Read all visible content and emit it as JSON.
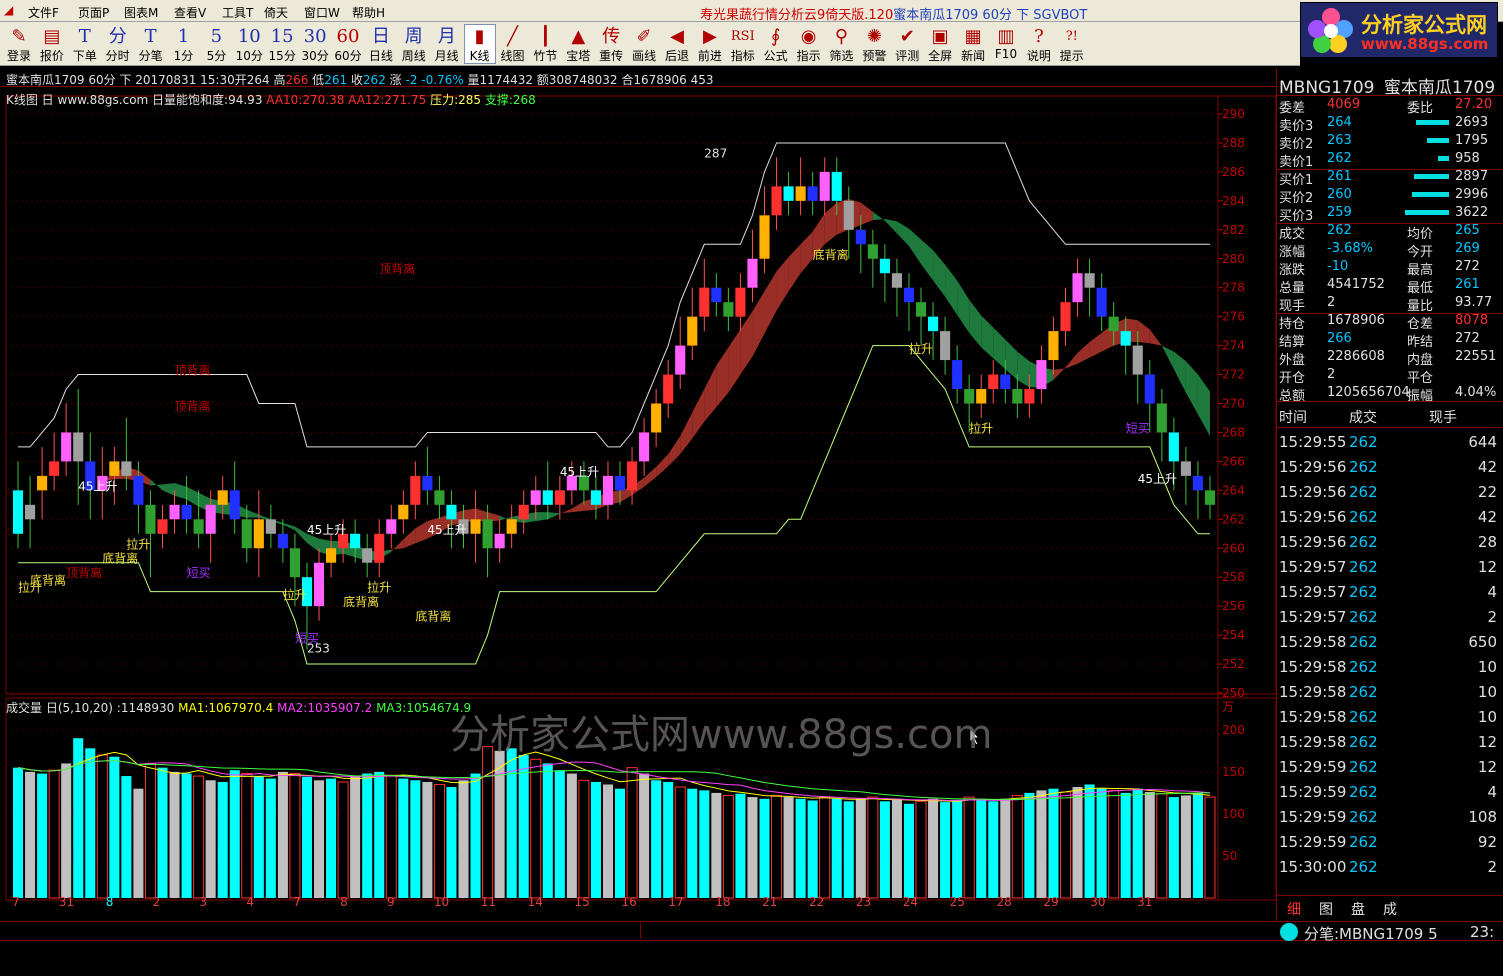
{
  "menu": {
    "items": [
      "文件F",
      "页面P",
      "图表M",
      "查看V",
      "工具T",
      "倚天",
      "窗口W",
      "帮助H"
    ],
    "title_a": "寿光果蔬行情分析云9倚天版.120",
    "title_b": "蜜本南瓜1709 60分 下 SGVBOT"
  },
  "logo": {
    "line1": "分析家公式网",
    "line2": "www.88gs.com"
  },
  "toolbar": [
    {
      "icon": "pencil-icon",
      "glyph": "✎",
      "label": "登录"
    },
    {
      "icon": "quote-icon",
      "glyph": "▤",
      "label": "报价"
    },
    {
      "icon": "order-icon",
      "glyph": "T",
      "label": "下单"
    },
    {
      "icon": "intraday-icon",
      "glyph": "分",
      "label": "分时"
    },
    {
      "icon": "tick-icon",
      "glyph": "T",
      "label": "分笔"
    },
    {
      "icon": "1min-icon",
      "glyph": "1",
      "label": "1分"
    },
    {
      "icon": "5min-icon",
      "glyph": "5",
      "label": "5分"
    },
    {
      "icon": "10min-icon",
      "glyph": "10",
      "label": "10分"
    },
    {
      "icon": "15min-icon",
      "glyph": "15",
      "label": "15分"
    },
    {
      "icon": "30min-icon",
      "glyph": "30",
      "label": "30分"
    },
    {
      "icon": "60min-icon",
      "glyph": "60",
      "label": "60分"
    },
    {
      "icon": "day-icon",
      "glyph": "日",
      "label": "日线"
    },
    {
      "icon": "week-icon",
      "glyph": "周",
      "label": "周线"
    },
    {
      "icon": "month-icon",
      "glyph": "月",
      "label": "月线"
    },
    {
      "icon": "candle-icon",
      "glyph": "▮",
      "label": "K线"
    },
    {
      "icon": "line-icon",
      "glyph": "╱",
      "label": "线图"
    },
    {
      "icon": "bamboo-icon",
      "glyph": "┃",
      "label": "竹节"
    },
    {
      "icon": "tower-icon",
      "glyph": "▲",
      "label": "宝塔"
    },
    {
      "icon": "retransmit-icon",
      "glyph": "传",
      "label": "重传"
    },
    {
      "icon": "draw-icon",
      "glyph": "✐",
      "label": "画线"
    },
    {
      "icon": "back-icon",
      "glyph": "◀",
      "label": "后退"
    },
    {
      "icon": "forward-icon",
      "glyph": "▶",
      "label": "前进"
    },
    {
      "icon": "indicator-icon",
      "glyph": "RSI",
      "label": "指标"
    },
    {
      "icon": "formula-icon",
      "glyph": "∮",
      "label": "公式"
    },
    {
      "icon": "hint-icon",
      "glyph": "◉",
      "label": "指示"
    },
    {
      "icon": "filter-icon",
      "glyph": "⚲",
      "label": "筛选"
    },
    {
      "icon": "alert-icon",
      "glyph": "✺",
      "label": "预警"
    },
    {
      "icon": "evaluate-icon",
      "glyph": "✔",
      "label": "评测"
    },
    {
      "icon": "fullscreen-icon",
      "glyph": "▣",
      "label": "全屏"
    },
    {
      "icon": "news-icon",
      "glyph": "▦",
      "label": "新闻"
    },
    {
      "icon": "f10-icon",
      "glyph": "▥",
      "label": "F10"
    },
    {
      "icon": "help-icon",
      "glyph": "?",
      "label": "说明"
    },
    {
      "icon": "tip-icon",
      "glyph": "?!",
      "label": "提示"
    }
  ],
  "infobar": {
    "text": "蜜本南瓜1709 60分 下  20170831 15:30开264 高",
    "high": "266",
    "low_l": " 低",
    "low": "261",
    "close_l": " 收",
    "close": "262",
    "chg_l": " 涨",
    "chg": "-2",
    "pct": "-0.76%",
    "rest": " 量1174432 额308748032 合1678906 453"
  },
  "kline_header": {
    "name": "K线图 日 www.88gs.com 日量能饱和度:94.93",
    "aa10": "AA10:270.38",
    "aa12": "AA12:271.75",
    "press": "压力:285",
    "support": "支撑:268"
  },
  "vol_header": {
    "name": "成交量 日(5,10,20) :1148930",
    "ma1": "MA1:1067970.4",
    "ma2": "MA2:1035907.2",
    "ma3": "MA3:1054674.9"
  },
  "watermark": "分析家公式网www.88gs.com",
  "price_ticks": [
    "290",
    "288",
    "286",
    "284",
    "282",
    "280",
    "278",
    "276",
    "274",
    "272",
    "270",
    "268",
    "266",
    "264",
    "262",
    "260",
    "258",
    "256",
    "254",
    "252",
    "250"
  ],
  "vol_ticks": [
    "万",
    "200",
    "150",
    "100",
    "50"
  ],
  "date_axis": [
    "7",
    "31",
    "8",
    "2",
    "3",
    "4",
    "7",
    "8",
    "9",
    "10",
    "11",
    "14",
    "15",
    "16",
    "17",
    "18",
    "21",
    "22",
    "23",
    "24",
    "25",
    "28",
    "29",
    "30",
    "31"
  ],
  "annotations": [
    {
      "t": "287",
      "c": "#e0e0e0"
    },
    {
      "t": "253",
      "c": "#e0e0e0"
    },
    {
      "t": "顶背离",
      "c": "#c00000"
    },
    {
      "t": "顶背离",
      "c": "#c00000"
    },
    {
      "t": "顶背离",
      "c": "#c00000"
    },
    {
      "t": "顶背离",
      "c": "#c00000"
    },
    {
      "t": "底背离",
      "c": "#f0e040"
    },
    {
      "t": "底背离",
      "c": "#f0e040"
    },
    {
      "t": "底背离",
      "c": "#f0e040"
    },
    {
      "t": "底背离",
      "c": "#f0e040"
    },
    {
      "t": "底背离",
      "c": "#f0e040"
    },
    {
      "t": "拉升",
      "c": "#f0e040"
    },
    {
      "t": "拉升",
      "c": "#f0e040"
    },
    {
      "t": "拉升",
      "c": "#f0e040"
    },
    {
      "t": "拉升",
      "c": "#f0e040"
    },
    {
      "t": "拉升",
      "c": "#f0e040"
    },
    {
      "t": "拉升",
      "c": "#f0e040"
    },
    {
      "t": "短买",
      "c": "#a030ff"
    },
    {
      "t": "短买",
      "c": "#a030ff"
    },
    {
      "t": "短买",
      "c": "#a030ff"
    },
    {
      "t": "45上升",
      "c": "#ffffff"
    },
    {
      "t": "45上升",
      "c": "#ffffff"
    },
    {
      "t": "45上升",
      "c": "#ffffff"
    },
    {
      "t": "45上升",
      "c": "#ffffff"
    },
    {
      "t": "45上升",
      "c": "#ffffff"
    }
  ],
  "chart_data": [
    {
      "type": "candlestick",
      "title": "K线图",
      "interval": "60分",
      "y_range": [
        250,
        290
      ],
      "candles": [
        [
          264,
          261,
          266,
          260
        ],
        [
          263,
          262,
          265,
          260
        ],
        [
          264,
          265,
          267,
          262
        ],
        [
          265,
          266,
          268,
          264
        ],
        [
          266,
          268,
          270,
          265
        ],
        [
          268,
          266,
          271,
          263
        ],
        [
          266,
          264,
          268,
          262
        ],
        [
          264,
          265,
          267,
          262
        ],
        [
          265,
          266,
          267,
          263
        ],
        [
          266,
          265,
          269,
          264
        ],
        [
          265,
          263,
          266,
          261
        ],
        [
          263,
          261,
          264,
          258
        ],
        [
          261,
          262,
          263,
          260
        ],
        [
          262,
          263,
          264,
          261
        ],
        [
          263,
          262,
          265,
          261
        ],
        [
          262,
          261,
          264,
          260
        ],
        [
          261,
          263,
          264,
          259
        ],
        [
          263,
          264,
          265,
          262
        ],
        [
          264,
          262,
          266,
          261
        ],
        [
          262,
          260,
          263,
          259
        ],
        [
          260,
          262,
          264,
          258
        ],
        [
          262,
          261,
          263,
          260
        ],
        [
          261,
          260,
          262,
          259
        ],
        [
          260,
          258,
          261,
          256
        ],
        [
          258,
          256,
          259,
          253
        ],
        [
          256,
          259,
          260,
          255
        ],
        [
          259,
          260,
          261,
          258
        ],
        [
          260,
          261,
          262,
          259
        ],
        [
          261,
          260,
          262,
          259
        ],
        [
          260,
          259,
          261,
          258
        ],
        [
          259,
          261,
          262,
          258
        ],
        [
          261,
          262,
          263,
          260
        ],
        [
          262,
          263,
          264,
          261
        ],
        [
          263,
          265,
          266,
          262
        ],
        [
          265,
          264,
          267,
          263
        ],
        [
          264,
          263,
          265,
          262
        ],
        [
          263,
          262,
          264,
          260
        ],
        [
          262,
          261,
          263,
          260
        ],
        [
          261,
          262,
          264,
          259
        ],
        [
          262,
          260,
          263,
          258
        ],
        [
          260,
          261,
          262,
          259
        ],
        [
          261,
          262,
          263,
          260
        ],
        [
          262,
          263,
          264,
          261
        ],
        [
          263,
          264,
          265,
          262
        ],
        [
          264,
          263,
          266,
          262
        ],
        [
          263,
          264,
          265,
          262
        ],
        [
          264,
          265,
          266,
          263
        ],
        [
          265,
          264,
          266,
          263
        ],
        [
          264,
          263,
          265,
          262
        ],
        [
          263,
          265,
          266,
          262
        ],
        [
          265,
          264,
          266,
          263
        ],
        [
          264,
          266,
          267,
          263
        ],
        [
          266,
          268,
          269,
          265
        ],
        [
          268,
          270,
          271,
          267
        ],
        [
          270,
          272,
          273,
          269
        ],
        [
          272,
          274,
          276,
          271
        ],
        [
          274,
          276,
          278,
          273
        ],
        [
          276,
          278,
          280,
          275
        ],
        [
          278,
          277,
          279,
          276
        ],
        [
          277,
          276,
          278,
          275
        ],
        [
          276,
          278,
          279,
          275
        ],
        [
          278,
          280,
          282,
          277
        ],
        [
          280,
          283,
          285,
          279
        ],
        [
          283,
          285,
          287,
          282
        ],
        [
          285,
          284,
          286,
          283
        ],
        [
          284,
          285,
          287,
          283
        ],
        [
          285,
          284,
          286,
          283
        ],
        [
          284,
          286,
          287,
          283
        ],
        [
          286,
          284,
          287,
          283
        ],
        [
          284,
          282,
          285,
          280
        ],
        [
          282,
          281,
          283,
          279
        ],
        [
          281,
          280,
          282,
          278
        ],
        [
          280,
          279,
          281,
          277
        ],
        [
          279,
          278,
          280,
          276
        ],
        [
          278,
          277,
          279,
          275
        ],
        [
          277,
          276,
          278,
          274
        ],
        [
          276,
          275,
          277,
          273
        ],
        [
          275,
          273,
          276,
          272
        ],
        [
          273,
          271,
          274,
          270
        ],
        [
          271,
          270,
          272,
          268
        ],
        [
          270,
          271,
          272,
          269
        ],
        [
          271,
          272,
          273,
          270
        ],
        [
          272,
          271,
          273,
          270
        ],
        [
          271,
          270,
          272,
          269
        ],
        [
          270,
          271,
          272,
          269
        ],
        [
          271,
          273,
          274,
          270
        ],
        [
          273,
          275,
          276,
          272
        ],
        [
          275,
          277,
          278,
          274
        ],
        [
          277,
          279,
          280,
          276
        ],
        [
          279,
          278,
          280,
          276
        ],
        [
          278,
          276,
          279,
          275
        ],
        [
          276,
          275,
          277,
          274
        ],
        [
          275,
          274,
          276,
          272
        ],
        [
          274,
          272,
          275,
          270
        ],
        [
          272,
          270,
          273,
          268
        ],
        [
          270,
          268,
          271,
          266
        ],
        [
          268,
          266,
          269,
          264
        ],
        [
          266,
          265,
          267,
          263
        ],
        [
          265,
          264,
          266,
          262
        ],
        [
          264,
          263,
          265,
          262
        ]
      ]
    },
    {
      "type": "bar",
      "title": "成交量",
      "unit": "万",
      "y_range": [
        0,
        220
      ],
      "values": [
        155,
        150,
        148,
        152,
        160,
        190,
        178,
        170,
        168,
        145,
        130,
        160,
        155,
        150,
        148,
        145,
        140,
        138,
        152,
        148,
        145,
        142,
        150,
        148,
        144,
        140,
        142,
        138,
        145,
        148,
        150,
        146,
        142,
        140,
        138,
        135,
        132,
        140,
        148,
        180,
        175,
        178,
        170,
        165,
        160,
        152,
        148,
        140,
        138,
        135,
        130,
        155,
        148,
        140,
        138,
        132,
        130,
        128,
        125,
        122,
        124,
        120,
        118,
        122,
        120,
        118,
        116,
        120,
        118,
        115,
        118,
        120,
        115,
        118,
        112,
        115,
        118,
        114,
        116,
        120,
        118,
        115,
        118,
        122,
        125,
        128,
        130,
        126,
        132,
        135,
        130,
        128,
        125,
        130,
        126,
        124,
        120,
        122,
        125,
        120
      ]
    }
  ],
  "quote": {
    "title_code": "MBNG1709",
    "title_name": "蜜本南瓜1709",
    "weicha_l": "委差",
    "weicha": "4069",
    "weibi_l": "委比",
    "weibi": "27.20",
    "book": [
      {
        "l": "卖价3",
        "p": "264",
        "q": "2693",
        "bar": 0.75
      },
      {
        "l": "卖价2",
        "p": "263",
        "q": "1795",
        "bar": 0.5
      },
      {
        "l": "卖价1",
        "p": "262",
        "q": "958",
        "bar": 0.25
      },
      {
        "l": "买价1",
        "p": "261",
        "q": "2897",
        "bar": 0.8
      },
      {
        "l": "买价2",
        "p": "260",
        "q": "2996",
        "bar": 0.85
      },
      {
        "l": "买价3",
        "p": "259",
        "q": "3622",
        "bar": 1.0
      }
    ],
    "stats": [
      {
        "l": "成交",
        "v": "262",
        "l2": "均价",
        "v2": "265",
        "c": "#00c8ff",
        "c2": "#00c8ff"
      },
      {
        "l": "涨幅",
        "v": "-3.68%",
        "l2": "今开",
        "v2": "269",
        "c": "#00c8ff",
        "c2": "#00c8ff"
      },
      {
        "l": "涨跌",
        "v": "-10",
        "l2": "最高",
        "v2": "272",
        "c": "#00c8ff",
        "c2": "#e0e0e0"
      },
      {
        "l": "总量",
        "v": "4541752",
        "l2": "最低",
        "v2": "261",
        "c": "#e0e0e0",
        "c2": "#00c8ff"
      },
      {
        "l": "现手",
        "v": "2",
        "l2": "量比",
        "v2": "93.77",
        "c": "#e0e0e0",
        "c2": "#e0e0e0"
      },
      {
        "l": "持仓",
        "v": "1678906",
        "l2": "仓差",
        "v2": "8078",
        "c": "#e0e0e0",
        "c2": "#ff3030"
      },
      {
        "l": "结算",
        "v": "266",
        "l2": "昨结",
        "v2": "272",
        "c": "#00c8ff",
        "c2": "#e0e0e0"
      },
      {
        "l": "外盘",
        "v": "2286608",
        "l2": "内盘",
        "v2": "22551",
        "c": "#e0e0e0",
        "c2": "#e0e0e0"
      },
      {
        "l": "开仓",
        "v": "2",
        "l2": "平仓",
        "v2": "",
        "c": "#e0e0e0",
        "c2": "#e0e0e0"
      },
      {
        "l": "总额",
        "v": "1205656704",
        "l2": "振幅",
        "v2": "4.04%",
        "c": "#e0e0e0",
        "c2": "#e0e0e0"
      }
    ],
    "ticks_header": [
      "时间",
      "成交",
      "现手"
    ],
    "ticks": [
      [
        "15:29:55",
        "262",
        "644"
      ],
      [
        "15:29:56",
        "262",
        "42"
      ],
      [
        "15:29:56",
        "262",
        "22"
      ],
      [
        "15:29:56",
        "262",
        "42"
      ],
      [
        "15:29:56",
        "262",
        "28"
      ],
      [
        "15:29:57",
        "262",
        "12"
      ],
      [
        "15:29:57",
        "262",
        "4"
      ],
      [
        "15:29:57",
        "262",
        "2"
      ],
      [
        "15:29:58",
        "262",
        "650"
      ],
      [
        "15:29:58",
        "262",
        "10"
      ],
      [
        "15:29:58",
        "262",
        "10"
      ],
      [
        "15:29:58",
        "262",
        "10"
      ],
      [
        "15:29:58",
        "262",
        "12"
      ],
      [
        "15:29:59",
        "262",
        "12"
      ],
      [
        "15:29:59",
        "262",
        "4"
      ],
      [
        "15:29:59",
        "262",
        "108"
      ],
      [
        "15:29:59",
        "262",
        "92"
      ],
      [
        "15:30:00",
        "262",
        "2"
      ]
    ],
    "tabs": [
      "细",
      "图",
      "盘",
      "成"
    ]
  },
  "status": {
    "text": "分笔:MBNG1709 5",
    "time": "23:"
  },
  "colors": {
    "up": "#ff3030",
    "down": "#00ffff",
    "grid": "#800000",
    "accent": "#ffd020",
    "ma1": "#ffff00",
    "ma2": "#ff40ff",
    "ma3": "#40ff40"
  }
}
